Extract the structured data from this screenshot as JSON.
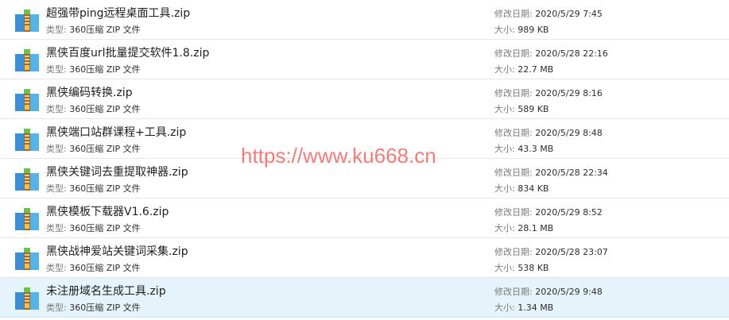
{
  "labels": {
    "type": "类型: ",
    "modified": "修改日期: ",
    "size": "大小: "
  },
  "files": [
    {
      "name": "超强带ping远程桌面工具.zip",
      "type": "360压缩 ZIP 文件",
      "modified": "2020/5/29 7:45",
      "size": "989 KB"
    },
    {
      "name": "黑侠百度url批量提交软件1.8.zip",
      "type": "360压缩 ZIP 文件",
      "modified": "2020/5/28 22:16",
      "size": "22.7 MB"
    },
    {
      "name": "黑侠编码转换.zip",
      "type": "360压缩 ZIP 文件",
      "modified": "2020/5/29 8:16",
      "size": "589 KB"
    },
    {
      "name": "黑侠端口站群课程+工具.zip",
      "type": "360压缩 ZIP 文件",
      "modified": "2020/5/29 8:48",
      "size": "43.3 MB"
    },
    {
      "name": "黑侠关键词去重提取神器.zip",
      "type": "360压缩 ZIP 文件",
      "modified": "2020/5/28 22:34",
      "size": "834 KB"
    },
    {
      "name": "黑侠模板下载器V1.6.zip",
      "type": "360压缩 ZIP 文件",
      "modified": "2020/5/29 8:52",
      "size": "28.1 MB"
    },
    {
      "name": "黑侠战神爱站关键词采集.zip",
      "type": "360压缩 ZIP 文件",
      "modified": "2020/5/28 23:07",
      "size": "538 KB"
    },
    {
      "name": "未注册域名生成工具.zip",
      "type": "360压缩 ZIP 文件",
      "modified": "2020/5/29 9:48",
      "size": "1.34 MB"
    }
  ],
  "selected_index": 7,
  "watermark": "https://www.ku668.cn",
  "icon": "zip-archive-icon",
  "colors": {
    "selected_row": "#e5f3fb",
    "watermark": "#ec6060"
  }
}
